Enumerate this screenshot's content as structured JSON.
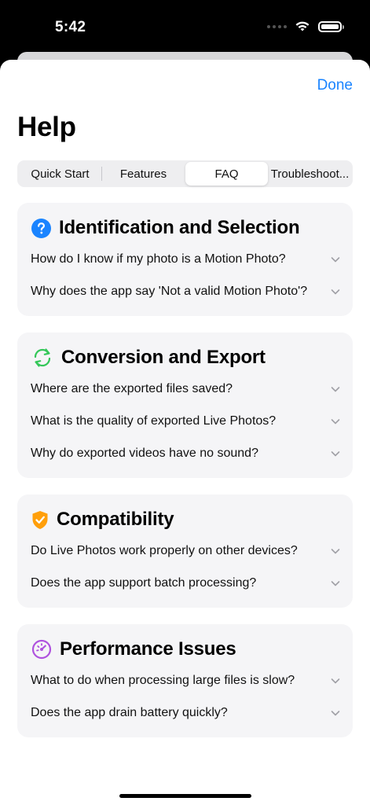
{
  "status": {
    "time": "5:42"
  },
  "header": {
    "done_label": "Done",
    "title": "Help"
  },
  "tabs": [
    {
      "label": "Quick Start",
      "active": false
    },
    {
      "label": "Features",
      "active": false
    },
    {
      "label": "FAQ",
      "active": true
    },
    {
      "label": "Troubleshoot...",
      "active": false
    }
  ],
  "sections": [
    {
      "title": "Identification and Selection",
      "icon": "question-circle-icon",
      "questions": [
        "How do I know if my photo is a Motion Photo?",
        "Why does the app say 'Not a valid Motion Photo'?"
      ]
    },
    {
      "title": "Conversion and Export",
      "icon": "arrows-cycle-icon",
      "questions": [
        "Where are the exported files saved?",
        "What is the quality of exported Live Photos?",
        "Why do exported videos have no sound?"
      ]
    },
    {
      "title": "Compatibility",
      "icon": "shield-check-icon",
      "questions": [
        "Do Live Photos work properly on other devices?",
        "Does the app support batch processing?"
      ]
    },
    {
      "title": "Performance Issues",
      "icon": "speedometer-icon",
      "questions": [
        "What to do when processing large files is slow?",
        "Does the app drain battery quickly?"
      ]
    }
  ],
  "colors": {
    "accent": "#1a84ff",
    "icon_blue": "#1a84ff",
    "icon_green": "#34c759",
    "icon_orange": "#ff9f0a",
    "icon_purple": "#af52de"
  }
}
